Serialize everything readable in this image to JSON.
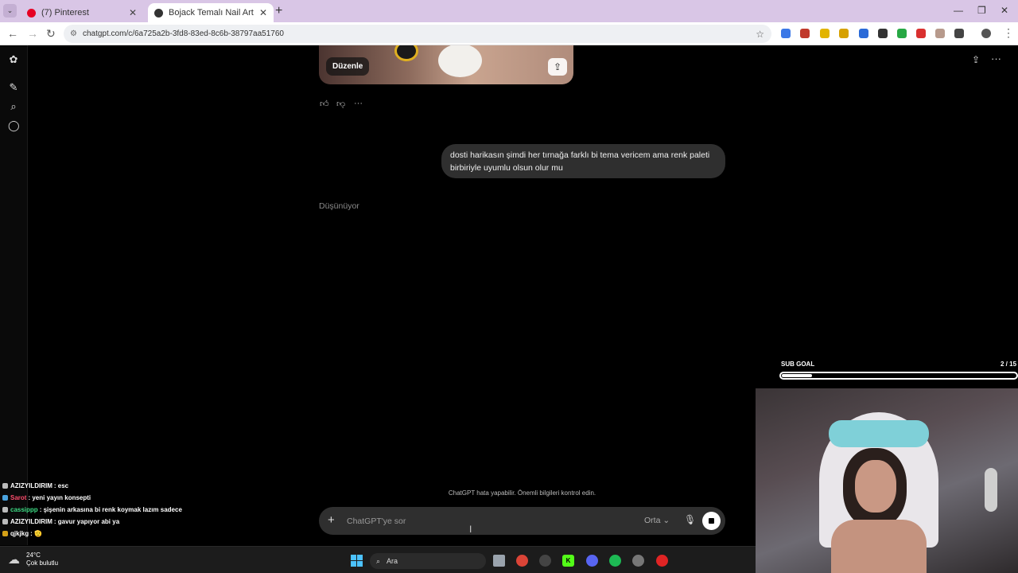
{
  "browser": {
    "tabs": [
      {
        "title": "(7) Pinterest",
        "favicon_color": "#e60023"
      },
      {
        "title": "Bojack Temalı Nail Art",
        "favicon_color": "#333333"
      }
    ],
    "url": "chatgpt.com/c/6a725a2b-3fd8-83ed-8c6b-38797aa51760"
  },
  "chat": {
    "image_edit_label": "Düzenle",
    "user_message": "dosti harikasın şimdi her tırnağa farklı bi tema vericem ama renk paleti birbiriyle uyumlu olsun olur mu",
    "thinking_label": "Düşünüyor",
    "disclaimer": "ChatGPT hata yapabilir. Önemli bilgileri kontrol edin.",
    "input_placeholder": "ChatGPT'ye sor",
    "model_label": "Orta"
  },
  "stream": {
    "chat": [
      {
        "user": "AZIZYILDIRIM",
        "message": ": esc",
        "color": "#ffffff"
      },
      {
        "user": "Sarot",
        "message": ": yeni yayın konsepti",
        "color": "#ff4d6d"
      },
      {
        "user": "cassippp",
        "message": ": şişenin arkasına bi renk koymak lazım sadece",
        "color": "#3ddc84"
      },
      {
        "user": "AZIZYILDIRIM",
        "message": ": gavur yapıyor abi ya",
        "color": "#ffffff"
      },
      {
        "user": "qjkjkg",
        "message": ": 🫡",
        "color": "#ffffff"
      }
    ],
    "subgoal": {
      "label": "SUB GOAL",
      "count": "2 / 15",
      "progress": 0.13
    }
  },
  "taskbar": {
    "weather_temp": "24°C",
    "weather_desc": "Çok bulutlu",
    "search_placeholder": "Ara"
  }
}
